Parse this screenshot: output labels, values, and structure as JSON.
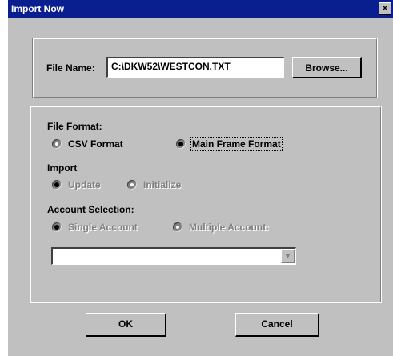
{
  "window": {
    "title": "Import Now",
    "close_glyph": "×"
  },
  "file_section": {
    "label": "File Name:",
    "value": "C:\\DKW52\\WESTCON.TXT",
    "browse_label": "Browse..."
  },
  "file_format": {
    "heading": "File Format:",
    "options": [
      "CSV Format",
      "Main Frame Format"
    ],
    "selected": "Main Frame Format"
  },
  "import": {
    "heading": "Import",
    "options": [
      "Update",
      "Initialize"
    ],
    "selected": "Update",
    "enabled": false
  },
  "account_selection": {
    "heading": "Account Selection:",
    "options": [
      "Single Account",
      "Multiple Account:"
    ],
    "selected": "Single Account",
    "enabled": false,
    "dropdown_value": "",
    "dropdown_arrow": "▼"
  },
  "buttons": {
    "ok": "OK",
    "cancel": "Cancel"
  },
  "colors": {
    "titlebar": "#0a1f8f",
    "face": "#c0c0c0",
    "disabled_text": "#808080"
  }
}
